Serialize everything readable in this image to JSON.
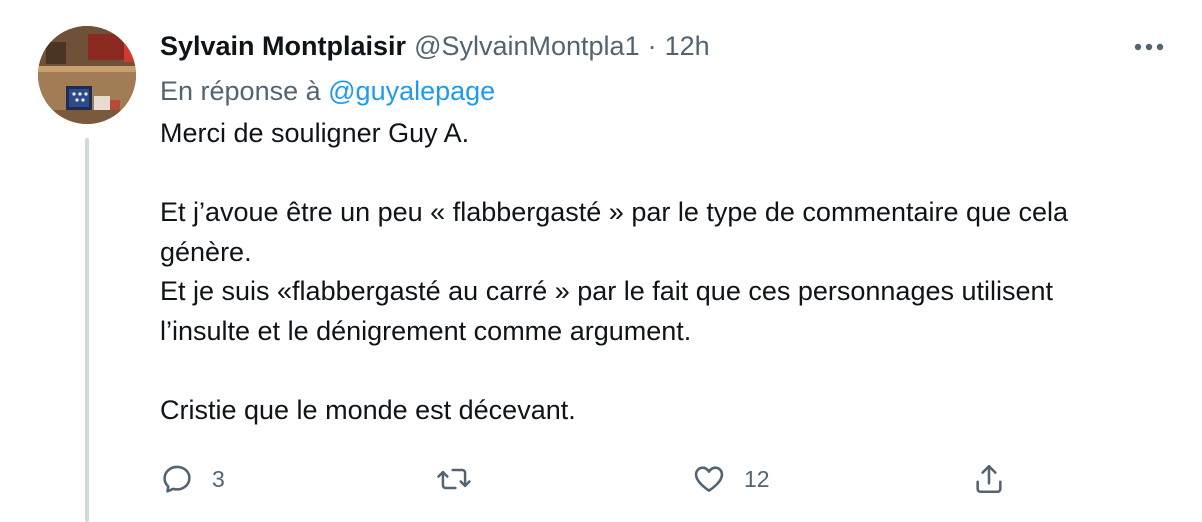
{
  "tweet": {
    "author": {
      "display_name": "Sylvain Montplaisir",
      "handle": "@SylvainMontpla1"
    },
    "separator": "·",
    "time": "12h",
    "reply_prefix": "En réponse à",
    "reply_to": "@guyalepage",
    "text": "Merci de souligner Guy A.\n\nEt j’avoue être un peu « flabbergasté » par le type de commentaire que cela\ngénère.\nEt je suis «flabbergasté au carré » par le fait que ces personnages utilisent\nl’insulte et le dénigrement comme argument.\n\nCristie que le monde est décevant.",
    "actions": {
      "reply": {
        "icon": "reply-icon",
        "count": "3"
      },
      "retweet": {
        "icon": "retweet-icon",
        "count": ""
      },
      "like": {
        "icon": "heart-icon",
        "count": "12"
      },
      "share": {
        "icon": "share-icon"
      }
    },
    "more_icon": "more-horizontal-icon"
  },
  "colors": {
    "primary_text": "#0f1419",
    "secondary_text": "#536471",
    "link": "#1d9bf0",
    "thread_line": "#cfd9de"
  }
}
